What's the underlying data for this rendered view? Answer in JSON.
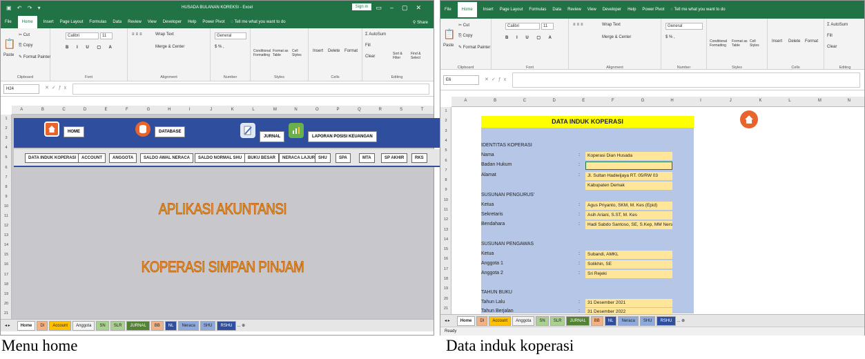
{
  "left": {
    "window_title": "HUSADA BULANAN KOREKSI  -  Excel",
    "sign_in": "Sign in",
    "menu": [
      "File",
      "Home",
      "Insert",
      "Page Layout",
      "Formulas",
      "Data",
      "Review",
      "View",
      "Developer",
      "Help",
      "Power Pivot",
      "Tell me what you want to do"
    ],
    "share": "Share",
    "ribbon": {
      "cut": "Cut",
      "copy": "Copy",
      "paste": "Paste",
      "format_painter": "Format Painter",
      "clipboard": "Clipboard",
      "font_name": "Calibri",
      "font_size": "11",
      "font": "Font",
      "wrap_text": "Wrap Text",
      "merge_center": "Merge & Center",
      "alignment": "Alignment",
      "number_format": "General",
      "number": "Number",
      "conditional": "Conditional Formatting",
      "format_as": "Format as Table",
      "cell_styles": "Cell Styles",
      "styles": "Styles",
      "insert": "Insert",
      "delete": "Delete",
      "format": "Format",
      "cells": "Cells",
      "autosum": "AutoSum",
      "fill": "Fill",
      "clear": "Clear",
      "sort_filter": "Sort & Filter",
      "find_select": "Find & Select",
      "editing": "Editing"
    },
    "name_box": "H24",
    "columns": [
      "A",
      "B",
      "C",
      "D",
      "E",
      "F",
      "G",
      "H",
      "I",
      "J",
      "K",
      "L",
      "M",
      "N",
      "O",
      "P",
      "Q",
      "R",
      "S",
      "T"
    ],
    "rows": [
      "1",
      "2",
      "3",
      "4",
      "5",
      "6",
      "7",
      "8",
      "9",
      "10",
      "11",
      "12",
      "13",
      "14",
      "15",
      "16",
      "17",
      "18",
      "19",
      "20",
      "21"
    ],
    "nav": {
      "home": "HOME",
      "database": "DATABASE",
      "jurnal": "JURNAL",
      "laporan": "LAPORAN POSISI KEUANGAN"
    },
    "subnav": [
      "DATA INDUK KOPERASI",
      "ACCOUNT",
      "ANGGOTA",
      "SALDO AWAL NERACA",
      "SALDO NORMAL SHU",
      "BUKU BESAR",
      "NERACA LAJUR",
      "SHU",
      "SPA",
      "MTA",
      "SP AKHIR",
      "RKS"
    ],
    "title1": "APLIKASI AKUNTANSI",
    "title2": "KOPERASI SIMPAN PINJAM",
    "tabs": [
      "Home",
      "DI",
      "Account",
      "Anggota",
      "SN",
      "SLR",
      "JURNAL",
      "BB",
      "NL",
      "Neraca",
      "SHU",
      "RSHU"
    ],
    "tab_more": "...",
    "caption": "Menu home"
  },
  "right": {
    "menu": [
      "File",
      "Home",
      "Insert",
      "Page Layout",
      "Formulas",
      "Data",
      "Review",
      "View",
      "Developer",
      "Help",
      "Power Pivot",
      "Tell me what you want to do"
    ],
    "name_box": "E6",
    "columns": [
      "A",
      "B",
      "C",
      "D",
      "E",
      "F",
      "G",
      "H",
      "I",
      "J",
      "K",
      "L",
      "M",
      "N"
    ],
    "rows": [
      "1",
      "2",
      "3",
      "4",
      "5",
      "6",
      "7",
      "8",
      "9",
      "10",
      "11",
      "12",
      "13",
      "14",
      "15",
      "16",
      "17",
      "18",
      "19",
      "20",
      "21"
    ],
    "title": "DATA INDUK KOPERASI",
    "sections": {
      "identitas": "IDENTITAS KOPERASI",
      "pengurus": "SUSUNAN PENGURUS'",
      "pengawas": "SUSUNAN PENGAWAS",
      "tahun": "TAHUN BUKU"
    },
    "fields": {
      "nama": {
        "label": "Nama",
        "value": "Koperasi Dian Husada"
      },
      "badan": {
        "label": "Badan Hukum",
        "value": ""
      },
      "alamat": {
        "label": "Alamat",
        "value": "Jl. Sultan Hadiwijaya RT. 05/RW 03"
      },
      "alamat2": {
        "value": "Kabupaten Demak"
      },
      "ketua": {
        "label": "Ketua",
        "value": "Agus Priyanto, SKM, M. Kes (Epid)"
      },
      "sekretaris": {
        "label": "Sekretaris",
        "value": "Asih Ariani, S.ST, M. Kes"
      },
      "bendahara": {
        "label": "Bendahara",
        "value": "Hadi Sabdo Santoso, SE, S.Kep, MM Ners"
      },
      "pengawas_ketua": {
        "label": "Ketua",
        "value": "Subandi, AMKL"
      },
      "anggota1": {
        "label": "Anggota 1",
        "value": "Solikhin, SE"
      },
      "anggota2": {
        "label": "Anggota 2",
        "value": "Sri Rejeki"
      },
      "tahun_lalu": {
        "label": "Tahun Lalu",
        "value": "31 Desember 2021"
      },
      "tahun_berjalan": {
        "label": "Tahun Berjalan",
        "value": "31 Desember 2022"
      }
    },
    "tabs": [
      "Home",
      "DI",
      "Account",
      "Anggota",
      "SN",
      "SLR",
      "JURNAL",
      "BB",
      "NL",
      "Neraca",
      "SHU",
      "RSHU"
    ],
    "tab_more": "...",
    "status": "Ready",
    "caption": "Data induk koperasi"
  },
  "colors": {
    "excel_green": "#217346",
    "nav_blue": "#2f4f9e",
    "title_yellow": "#ffff00",
    "sheet_blue": "#b5c6e7",
    "value_yellow": "#ffe699",
    "home_orange": "#e8642c"
  }
}
